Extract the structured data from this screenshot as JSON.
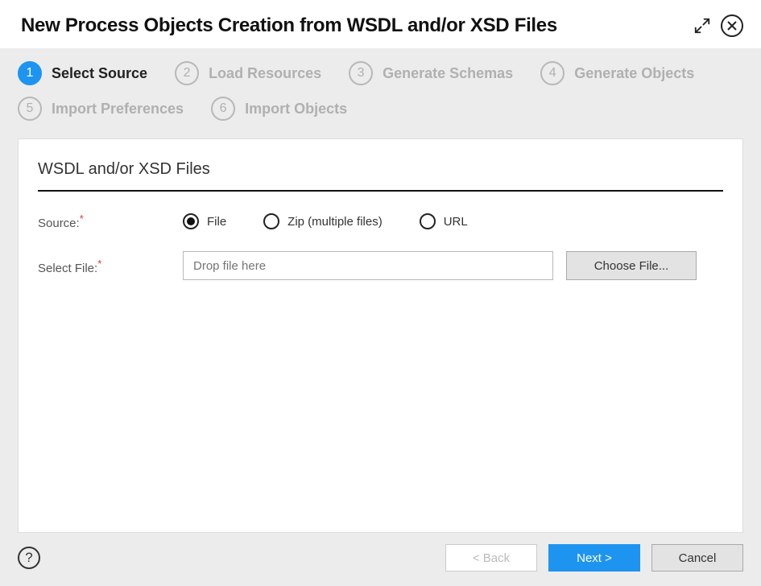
{
  "title": "New Process Objects Creation from WSDL and/or XSD Files",
  "steps": [
    {
      "num": "1",
      "label": "Select Source",
      "active": true
    },
    {
      "num": "2",
      "label": "Load Resources",
      "active": false
    },
    {
      "num": "3",
      "label": "Generate Schemas",
      "active": false
    },
    {
      "num": "4",
      "label": "Generate Objects",
      "active": false
    },
    {
      "num": "5",
      "label": "Import Preferences",
      "active": false
    },
    {
      "num": "6",
      "label": "Import Objects",
      "active": false
    }
  ],
  "panel": {
    "title": "WSDL and/or XSD Files",
    "source_label": "Source:",
    "select_file_label": "Select File:",
    "drop_placeholder": "Drop file here",
    "choose_file_label": "Choose File...",
    "radios": {
      "file": "File",
      "zip": "Zip (multiple files)",
      "url": "URL"
    }
  },
  "footer": {
    "back": "< Back",
    "next": "Next >",
    "cancel": "Cancel",
    "help": "?"
  }
}
